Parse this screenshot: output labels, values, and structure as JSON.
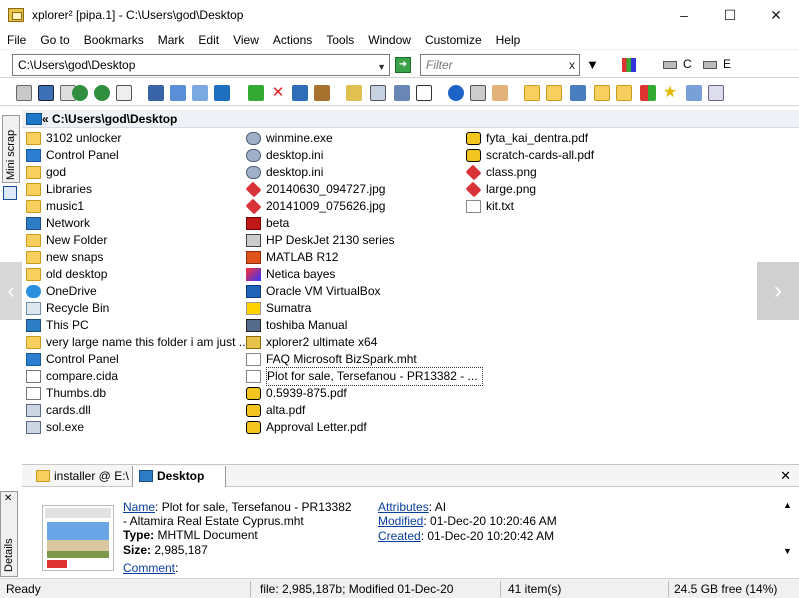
{
  "window": {
    "title": "xplorer² [pipa.1] - C:\\Users\\god\\Desktop",
    "controls": [
      "–",
      "☐",
      "✕"
    ]
  },
  "menu": [
    "File",
    "Go to",
    "Bookmarks",
    "Mark",
    "Edit",
    "View",
    "Actions",
    "Tools",
    "Window",
    "Customize",
    "Help"
  ],
  "address": {
    "value": "C:\\Users\\god\\Desktop",
    "filter_placeholder": "Filter",
    "filter_clear": "x",
    "drive_c": "C",
    "drive_e": "E"
  },
  "sidebar": {
    "mini_scrap_label": "Mini scrap"
  },
  "pane": {
    "path": "« C:\\Users\\god\\Desktop",
    "col1": [
      {
        "name": "3102 unlocker",
        "icon": "folder-icon"
      },
      {
        "name": "Control Panel",
        "icon": "control-panel-icon"
      },
      {
        "name": "god",
        "icon": "user-folder-icon"
      },
      {
        "name": "Libraries",
        "icon": "libraries-icon"
      },
      {
        "name": "music1",
        "icon": "folder-icon"
      },
      {
        "name": "Network",
        "icon": "network-icon"
      },
      {
        "name": "New Folder",
        "icon": "folder-icon"
      },
      {
        "name": "new snaps",
        "icon": "folder-icon"
      },
      {
        "name": "old desktop",
        "icon": "folder-icon"
      },
      {
        "name": "OneDrive",
        "icon": "onedrive-icon"
      },
      {
        "name": "Recycle Bin",
        "icon": "recycle-bin-icon"
      },
      {
        "name": "This PC",
        "icon": "this-pc-icon"
      },
      {
        "name": "very large name this folder i am just ...",
        "icon": "folder-icon"
      },
      {
        "name": "Control Panel",
        "icon": "control-panel-icon"
      },
      {
        "name": "compare.cida",
        "icon": "generic-file-icon"
      },
      {
        "name": "Thumbs.db",
        "icon": "generic-file-icon"
      },
      {
        "name": "cards.dll",
        "icon": "dll-icon"
      },
      {
        "name": "sol.exe",
        "icon": "exe-icon"
      }
    ],
    "col2": [
      {
        "name": "winmine.exe",
        "icon": "gear-file-icon"
      },
      {
        "name": "desktop.ini",
        "icon": "gear-file-icon"
      },
      {
        "name": "desktop.ini",
        "icon": "gear-file-icon"
      },
      {
        "name": "20140630_094727.jpg",
        "icon": "image-icon"
      },
      {
        "name": "20141009_075626.jpg",
        "icon": "image-icon"
      },
      {
        "name": "beta",
        "icon": "shortcut-icon"
      },
      {
        "name": "HP DeskJet 2130 series",
        "icon": "printer-icon"
      },
      {
        "name": "MATLAB R12",
        "icon": "matlab-icon"
      },
      {
        "name": "Netica bayes",
        "icon": "netica-icon"
      },
      {
        "name": "Oracle VM VirtualBox",
        "icon": "virtualbox-icon"
      },
      {
        "name": "Sumatra",
        "icon": "sumatra-icon"
      },
      {
        "name": "toshiba Manual",
        "icon": "manual-icon"
      },
      {
        "name": "xplorer2 ultimate x64",
        "icon": "xplorer-icon"
      },
      {
        "name": "FAQ  Microsoft BizSpark.mht",
        "icon": "document-icon"
      },
      {
        "name": "Plot for sale, Tersefanou - PR13382 - ...",
        "icon": "document-icon",
        "selected": true
      },
      {
        "name": "0.5939-875.pdf",
        "icon": "pdf-icon"
      },
      {
        "name": "alta.pdf",
        "icon": "pdf-icon"
      },
      {
        "name": "Approval Letter.pdf",
        "icon": "pdf-icon"
      }
    ],
    "col3": [
      {
        "name": "fyta_kai_dentra.pdf",
        "icon": "pdf-icon"
      },
      {
        "name": "scratch-cards-all.pdf",
        "icon": "pdf-icon"
      },
      {
        "name": "class.png",
        "icon": "image-icon"
      },
      {
        "name": "large.png",
        "icon": "image-icon"
      },
      {
        "name": "kit.txt",
        "icon": "text-file-icon"
      }
    ]
  },
  "tabs": [
    {
      "label": "installer @ E:\\",
      "active": false
    },
    {
      "label": "Desktop",
      "active": true
    }
  ],
  "tab_close": "✕",
  "details": {
    "side_label": "Details",
    "name_label": "Name",
    "name_value": "Plot for sale, Tersefanou - PR13382",
    "name_value2": "- Altamira Real Estate Cyprus.mht",
    "type_label": "Type",
    "type_value": "MHTML Document",
    "size_label": "Size",
    "size_value": "2,985,187",
    "comment_label": "Comment",
    "attributes_label": "Attributes",
    "attributes_value": "AI",
    "modified_label": "Modified",
    "modified_value": "01-Dec-20 10:20:46 AM",
    "created_label": "Created",
    "created_value": "01-Dec-20 10:20:42 AM"
  },
  "status": {
    "ready": "Ready",
    "file_info": "file: 2,985,187b; Modified 01-Dec-20",
    "items": "41 item(s)",
    "free": "24.5 GB free (14%)"
  }
}
